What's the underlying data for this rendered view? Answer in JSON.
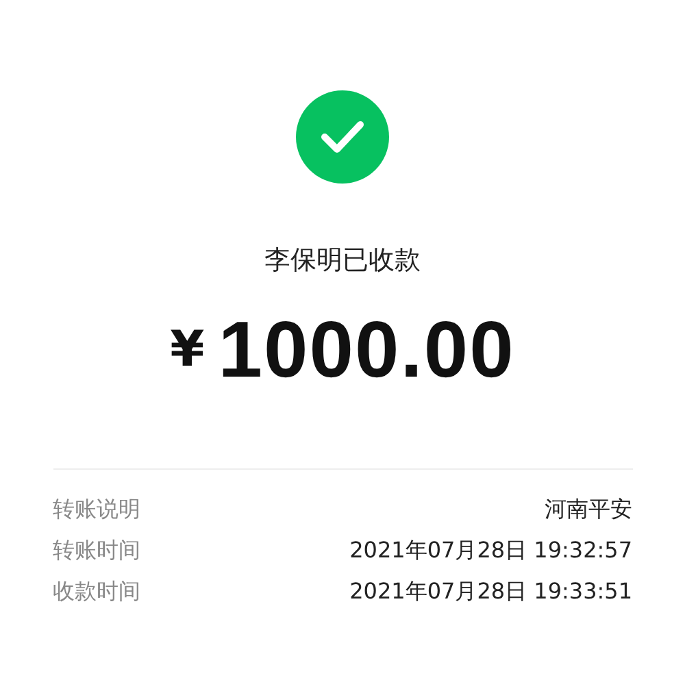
{
  "status": {
    "text": "李保明已收款",
    "success": true
  },
  "amount": {
    "currency": "¥",
    "value": "1000.00"
  },
  "details": [
    {
      "label": "转账说明",
      "value": "河南平安"
    },
    {
      "label": "转账时间",
      "value": "2021年07月28日 19:32:57"
    },
    {
      "label": "收款时间",
      "value": "2021年07月28日 19:33:51"
    }
  ]
}
